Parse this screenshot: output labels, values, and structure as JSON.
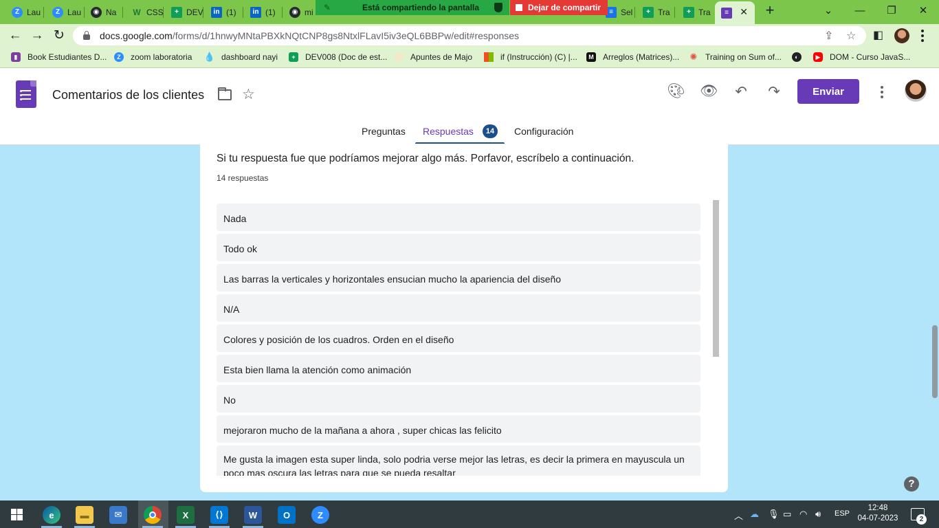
{
  "browser": {
    "tabs": [
      {
        "label": "Lau",
        "icon": "zoom-icon",
        "color": "#2d8cff"
      },
      {
        "label": "Lau",
        "icon": "zoom-icon",
        "color": "#2d8cff"
      },
      {
        "label": "Na",
        "icon": "github-icon",
        "color": "#24292e"
      },
      {
        "label": "CSS",
        "icon": "w-icon",
        "color": "#3aa757"
      },
      {
        "label": "DEV",
        "icon": "sheets-icon",
        "color": "#0f9d58"
      },
      {
        "label": "(1)",
        "icon": "linkedin-icon",
        "color": "#0a66c2"
      },
      {
        "label": "(1)",
        "icon": "linkedin-icon",
        "color": "#0a66c2"
      },
      {
        "label": "mi",
        "icon": "github-icon",
        "color": "#24292e"
      },
      {
        "label": "Sel",
        "icon": "docs-icon",
        "color": "#1a73e8"
      },
      {
        "label": "Tra",
        "icon": "sheets-icon",
        "color": "#0f9d58"
      },
      {
        "label": "Tra",
        "icon": "sheets-icon",
        "color": "#0f9d58"
      },
      {
        "label": "",
        "icon": "forms-icon",
        "color": "#673ab7"
      }
    ],
    "new_tab": "+",
    "window_controls": {
      "minimize": "⌄",
      "restore": "—",
      "maximize": "❐",
      "close": "✕"
    },
    "share_banner": "Está compartiendo la pantalla",
    "stop_share": "Dejar de compartir",
    "url_host": "docs.google.com",
    "url_path": "/forms/d/1hnwyMNtaPBXkNQtCNP8gs8NtxlFLavI5iv3eQL6BBPw/edit#responses",
    "bookmarks": [
      {
        "label": "Book Estudiantes D...",
        "icon": "book-icon",
        "color": "#7b3fa0"
      },
      {
        "label": "zoom laboratoria",
        "icon": "zoom-icon",
        "color": "#2d8cff"
      },
      {
        "label": "dashboard nayi",
        "icon": "drop-icon",
        "color": "#4a90e2"
      },
      {
        "label": "DEV008 (Doc de est...",
        "icon": "sheets-icon",
        "color": "#0f9d58"
      },
      {
        "label": "Apuntes de Majo",
        "icon": "circle-icon",
        "color": "#f1e9c9"
      },
      {
        "label": "if (Instrucción) (C) |...",
        "icon": "microsoft-icon",
        "color": "#f25022"
      },
      {
        "label": "Arreglos (Matrices)...",
        "icon": "m-icon",
        "color": "#111111"
      },
      {
        "label": "Training on Sum of...",
        "icon": "swirl-icon",
        "color": "#e2533c"
      },
      {
        "label": "",
        "icon": "globe-icon",
        "color": "#202124"
      },
      {
        "label": "DOM - Curso JavaS...",
        "icon": "youtube-icon",
        "color": "#ff0000"
      }
    ]
  },
  "forms": {
    "title": "Comentarios de los clientes",
    "send_label": "Enviar",
    "tabs": {
      "questions": "Preguntas",
      "responses": "Respuestas",
      "responses_count": "14",
      "settings": "Configuración"
    }
  },
  "question": {
    "text": "Si tu respuesta fue que podríamos mejorar algo más. Porfavor, escríbelo a continuación.",
    "count_label": "14 respuestas",
    "answers": [
      "Nada",
      "Todo ok",
      "Las barras la verticales y horizontales ensucian mucho la apariencia del diseño",
      "N/A",
      "Colores y posición de los cuadros. Orden en el diseño",
      "Esta bien llama la atención como animación",
      "No",
      "mejoraron mucho de la mañana a ahora , super chicas las felicito",
      "Me gusta la imagen esta super linda, solo podria verse mejor las letras, es decir la primera en mayuscula un poco mas oscura las letras para que se pueda resaltar"
    ]
  },
  "taskbar": {
    "lang": "ESP",
    "time": "12:48",
    "date": "04-07-2023",
    "notifications": "2",
    "colors": {
      "accent": "#673ab7",
      "background": "#b3e5fa",
      "chrome": "#7cc64b"
    }
  }
}
